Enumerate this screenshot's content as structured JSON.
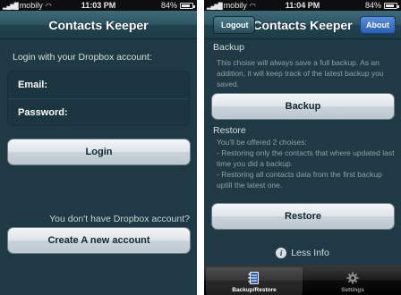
{
  "status": {
    "left": {
      "carrier": "mobily",
      "time": "11:03 PM",
      "battery": "84%",
      "battery_level": 0.84
    },
    "right": {
      "carrier": "mobily",
      "time": "11:04 PM",
      "battery": "84%",
      "battery_level": 0.84
    }
  },
  "login_screen": {
    "title": "Contacts Keeper",
    "prompt": "Login with your Dropbox account:",
    "email_label": "Email:",
    "password_label": "Password:",
    "login_button": "Login",
    "no_account_text": "You don't have Dropbox account?",
    "create_button": "Create A new account"
  },
  "backup_screen": {
    "title": "Contacts Keeper",
    "logout_button": "Logout",
    "about_button": "About",
    "backup_title": "Backup",
    "backup_text": "This choise will always save a full backup. As an addition, it will keep track of the latest backup you saved.",
    "backup_button": "Backup",
    "restore_title": "Restore",
    "restore_text_1": "You'll be offered 2 choises:",
    "restore_text_2": "- Restoring only the contacts that where updated last time you did a backup.",
    "restore_text_3": "- Restoring all contacts data from the first backup uptill the latest one.",
    "restore_button": "Restore",
    "less_info": "Less Info",
    "info_icon_glyph": "i",
    "tabs": [
      {
        "label": "Backup/Restore",
        "icon": "notebook-icon",
        "active": true
      },
      {
        "label": "Settings",
        "icon": "gear-icon",
        "active": false
      }
    ]
  },
  "colors": {
    "background": "#1f3a44",
    "navbar": "#2d5562",
    "about_button": "#2a5fb8",
    "button_light": "#dde3e8"
  }
}
